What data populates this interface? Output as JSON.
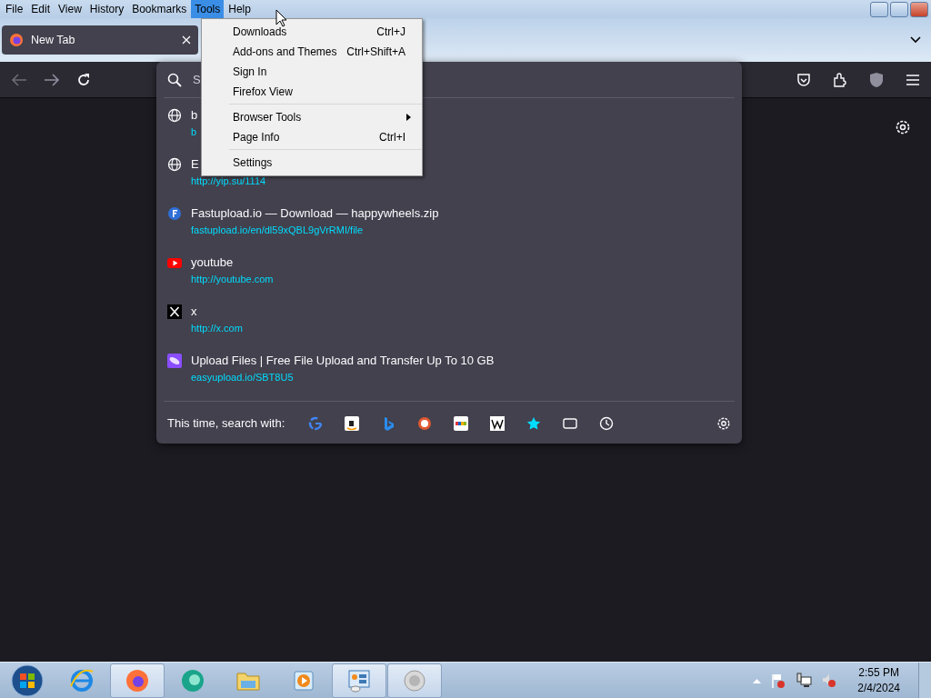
{
  "menu_bar": [
    {
      "label": "File",
      "selected": false
    },
    {
      "label": "Edit",
      "selected": false
    },
    {
      "label": "View",
      "selected": false
    },
    {
      "label": "History",
      "selected": false
    },
    {
      "label": "Bookmarks",
      "selected": false
    },
    {
      "label": "Tools",
      "selected": true
    },
    {
      "label": "Help",
      "selected": false
    }
  ],
  "tabs": [
    {
      "title": "New Tab",
      "selected": true
    }
  ],
  "address_bar": {
    "placeholder": "S"
  },
  "results": [
    {
      "kind": "globe",
      "title": "b",
      "url": "b"
    },
    {
      "kind": "globe",
      "title": "E",
      "url": "http://yip.su/1114"
    },
    {
      "kind": "fastupload",
      "title": "Fastupload.io — Download — happywheels.zip",
      "url": "fastupload.io/en/dl59xQBL9gVrRMI/file"
    },
    {
      "kind": "youtube",
      "title": "youtube",
      "url": "http://youtube.com"
    },
    {
      "kind": "x",
      "title": "x",
      "url": "http://x.com"
    },
    {
      "kind": "easyupload",
      "title": "Upload Files | Free File Upload and Transfer Up To 10 GB",
      "url": "easyupload.io/SBT8U5"
    }
  ],
  "search_with": {
    "label": "This time, search with:"
  },
  "tools_menu": [
    {
      "kind": "item",
      "label": "Downloads",
      "shortcut": "Ctrl+J"
    },
    {
      "kind": "item",
      "label": "Add-ons and Themes",
      "shortcut": "Ctrl+Shift+A"
    },
    {
      "kind": "item",
      "label": "Sign In"
    },
    {
      "kind": "item",
      "label": "Firefox View"
    },
    {
      "kind": "separator"
    },
    {
      "kind": "submenu",
      "label": "Browser Tools"
    },
    {
      "kind": "item",
      "label": "Page Info",
      "shortcut": "Ctrl+I"
    },
    {
      "kind": "separator"
    },
    {
      "kind": "item",
      "label": "Settings"
    }
  ],
  "taskbar": {
    "apps": [
      {
        "kind": "ie",
        "selected": false
      },
      {
        "kind": "firefox",
        "selected": true
      },
      {
        "kind": "orb",
        "selected": false
      },
      {
        "kind": "folder",
        "selected": false
      },
      {
        "kind": "media",
        "selected": false
      },
      {
        "kind": "panel",
        "selected": true
      },
      {
        "kind": "speaker",
        "selected": true
      }
    ],
    "time": "2:55 PM",
    "date": "2/4/2024"
  }
}
